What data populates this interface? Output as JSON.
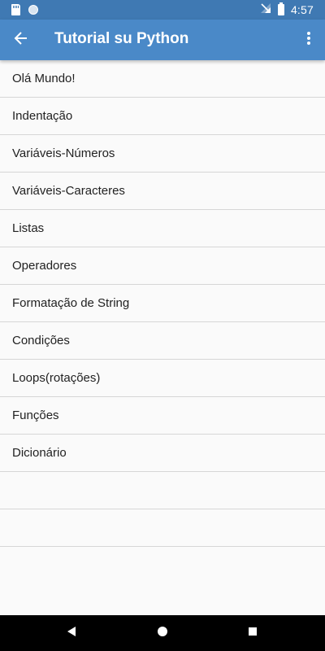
{
  "status_bar": {
    "time": "4:57",
    "icons": [
      "sd-card-icon",
      "circle-icon",
      "no-signal-icon",
      "battery-icon"
    ]
  },
  "app_bar": {
    "title": "Tutorial su Python",
    "background": "#4a89c8",
    "status_background": "#3f79b3"
  },
  "list": {
    "items": [
      {
        "label": "Olá Mundo!"
      },
      {
        "label": "Indentação"
      },
      {
        "label": "Variáveis-Números"
      },
      {
        "label": "Variáveis-Caracteres"
      },
      {
        "label": "Listas"
      },
      {
        "label": "Operadores"
      },
      {
        "label": "Formatação de String"
      },
      {
        "label": "Condições"
      },
      {
        "label": "Loops(rotações)"
      },
      {
        "label": "Funções"
      },
      {
        "label": "Dicionário"
      },
      {
        "label": ""
      },
      {
        "label": ""
      }
    ]
  },
  "nav_bar": {
    "buttons": [
      "back-triangle-icon",
      "home-circle-icon",
      "recents-square-icon"
    ]
  }
}
